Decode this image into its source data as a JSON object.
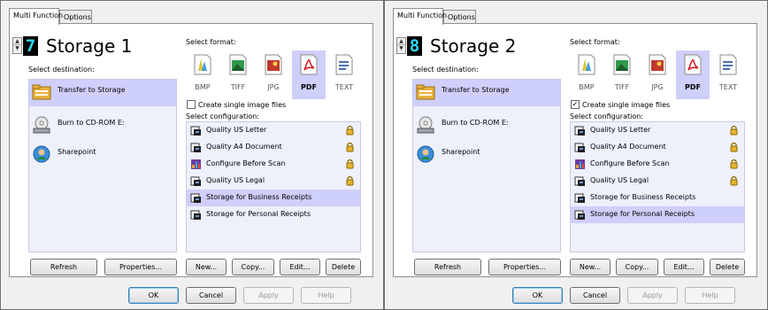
{
  "colors": {
    "selection": "#cfcffb",
    "list_background": "#eef0fb",
    "digit_background": "#000000",
    "digit_color": "#2fd9f0",
    "dialog_background": "#f0f0f0"
  },
  "dialogs": [
    {
      "tabs": [
        {
          "label": "Multi Function"
        },
        {
          "label": "Options"
        }
      ],
      "digit": "7",
      "profile_name": "Storage 1",
      "select_destination_label": "Select destination:",
      "destinations": [
        {
          "label": "Transfer to Storage",
          "icon": "folder-icon"
        },
        {
          "label": "Burn to CD-ROM  E:",
          "icon": "cd-burner-icon"
        },
        {
          "label": "Sharepoint",
          "icon": "sharepoint-icon"
        }
      ],
      "selected_destination": "Transfer to Storage",
      "select_format_label": "Select format:",
      "formats": [
        {
          "label": "BMP",
          "icon": "bmp-format-icon"
        },
        {
          "label": "TIFF",
          "icon": "tiff-format-icon"
        },
        {
          "label": "JPG",
          "icon": "jpg-format-icon"
        },
        {
          "label": "PDF",
          "icon": "pdf-format-icon"
        },
        {
          "label": "TEXT",
          "icon": "text-format-icon"
        }
      ],
      "selected_format": "PDF",
      "single_image_label": "Create single image files",
      "single_image_checked": false,
      "select_configuration_label": "Select configuration:",
      "configurations": [
        {
          "label": "Quality US Letter",
          "icon": "scanner-icon",
          "locked": true
        },
        {
          "label": "Quality A4 Document",
          "icon": "scanner-icon",
          "locked": true
        },
        {
          "label": "Configure Before Scan",
          "icon": "configure-scan-icon",
          "locked": true
        },
        {
          "label": "Quality US Legal",
          "icon": "scanner-icon",
          "locked": true
        },
        {
          "label": "Storage for Business Receipts",
          "icon": "scanner-icon",
          "locked": false
        },
        {
          "label": "Storage for Personal Receipts",
          "icon": "scanner-icon",
          "locked": false
        }
      ],
      "selected_configuration": "Storage for Business Receipts",
      "buttons": {
        "refresh": "Refresh",
        "properties": "Properties...",
        "new": "New...",
        "copy": "Copy...",
        "edit": "Edit...",
        "delete": "Delete",
        "ok": "OK",
        "cancel": "Cancel",
        "apply": "Apply",
        "help": "Help"
      }
    },
    {
      "tabs": [
        {
          "label": "Multi Function"
        },
        {
          "label": "Options"
        }
      ],
      "digit": "8",
      "profile_name": "Storage 2",
      "select_destination_label": "Select destination:",
      "destinations": [
        {
          "label": "Transfer to Storage",
          "icon": "folder-icon"
        },
        {
          "label": "Burn to CD-ROM  E:",
          "icon": "cd-burner-icon"
        },
        {
          "label": "Sharepoint",
          "icon": "sharepoint-icon"
        }
      ],
      "selected_destination": "Transfer to Storage",
      "select_format_label": "Select format:",
      "formats": [
        {
          "label": "BMP",
          "icon": "bmp-format-icon"
        },
        {
          "label": "TIFF",
          "icon": "tiff-format-icon"
        },
        {
          "label": "JPG",
          "icon": "jpg-format-icon"
        },
        {
          "label": "PDF",
          "icon": "pdf-format-icon"
        },
        {
          "label": "TEXT",
          "icon": "text-format-icon"
        }
      ],
      "selected_format": "PDF",
      "single_image_label": "Create single image files",
      "single_image_checked": true,
      "select_configuration_label": "Select configuration:",
      "configurations": [
        {
          "label": "Quality US Letter",
          "icon": "scanner-icon",
          "locked": true
        },
        {
          "label": "Quality A4 Document",
          "icon": "scanner-icon",
          "locked": true
        },
        {
          "label": "Configure Before Scan",
          "icon": "configure-scan-icon",
          "locked": true
        },
        {
          "label": "Quality US Legal",
          "icon": "scanner-icon",
          "locked": true
        },
        {
          "label": "Storage for Business Receipts",
          "icon": "scanner-icon",
          "locked": false
        },
        {
          "label": "Storage for Personal Receipts",
          "icon": "scanner-icon",
          "locked": false
        }
      ],
      "selected_configuration": "Storage for Personal Receipts",
      "buttons": {
        "refresh": "Refresh",
        "properties": "Properties...",
        "new": "New...",
        "copy": "Copy...",
        "edit": "Edit...",
        "delete": "Delete",
        "ok": "OK",
        "cancel": "Cancel",
        "apply": "Apply",
        "help": "Help"
      }
    }
  ]
}
